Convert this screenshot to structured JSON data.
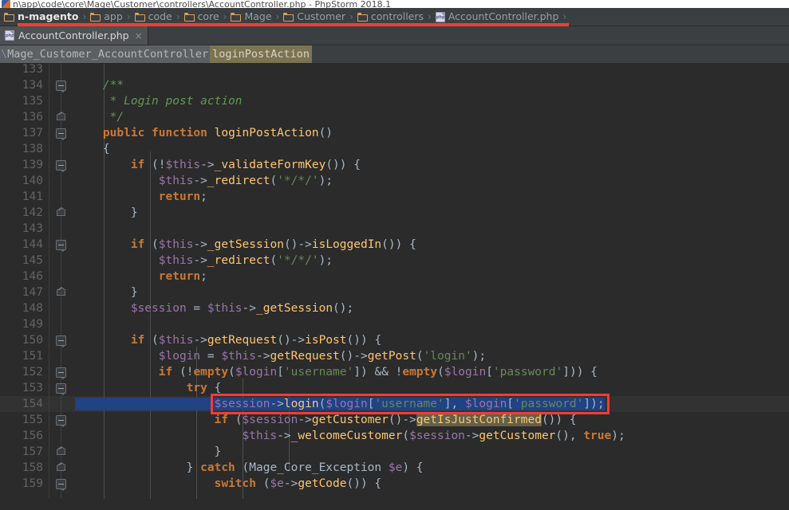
{
  "window": {
    "title": "n\\app\\code\\core\\Mage\\Customer\\controllers\\AccountController.php - PhpStorm 2018.1",
    "app_icon": "phpstorm-icon"
  },
  "breadcrumb": {
    "items": [
      {
        "label": "n-magento",
        "icon": "folder-icon",
        "current": true
      },
      {
        "label": "app",
        "icon": "folder-icon"
      },
      {
        "label": "code",
        "icon": "folder-icon"
      },
      {
        "label": "core",
        "icon": "folder-icon"
      },
      {
        "label": "Mage",
        "icon": "folder-icon"
      },
      {
        "label": "Customer",
        "icon": "folder-icon"
      },
      {
        "label": "controllers",
        "icon": "folder-icon"
      },
      {
        "label": "AccountController.php",
        "icon": "php-file-icon"
      }
    ],
    "separator": "›",
    "underline_color": "#f23b36"
  },
  "tabs": [
    {
      "label": "AccountController.php",
      "icon": "php-file-icon",
      "close": "×",
      "active": true
    }
  ],
  "navstrip": {
    "class_prefix": "\\",
    "class_name": "Mage_Customer_AccountController",
    "method_name": "loginPostAction"
  },
  "colors": {
    "editor_bg": "#2b2b2b",
    "chrome_bg": "#3c3f41",
    "gutter_text": "#606366",
    "default_text": "#a9b7c6",
    "keyword": "#cc7832",
    "function": "#ffc66d",
    "variable": "#9876aa",
    "string": "#6a8759",
    "comment": "#629755",
    "selection": "#214283",
    "identifier_highlight": "#63614a",
    "annotation": "#f23b36",
    "current_line": "#323232"
  },
  "editor": {
    "first_line": 133,
    "lines": [
      {
        "n": 133,
        "partial_top": true,
        "fold": null,
        "tokens": []
      },
      {
        "n": 134,
        "fold": "minus",
        "tokens": [
          {
            "t": "    ",
            "c": "def"
          },
          {
            "t": "/**",
            "c": "cmt"
          }
        ]
      },
      {
        "n": 135,
        "fold": null,
        "tokens": [
          {
            "t": "     ",
            "c": "def"
          },
          {
            "t": "* Login post action",
            "c": "cmt"
          }
        ]
      },
      {
        "n": 136,
        "fold": "end",
        "tokens": [
          {
            "t": "     ",
            "c": "def"
          },
          {
            "t": "*/",
            "c": "cmt"
          }
        ]
      },
      {
        "n": 137,
        "fold": "minus",
        "tokens": [
          {
            "t": "    ",
            "c": "def"
          },
          {
            "t": "public function ",
            "c": "kw"
          },
          {
            "t": "loginPostAction",
            "c": "fn"
          },
          {
            "t": "()",
            "c": "punct"
          }
        ]
      },
      {
        "n": 138,
        "fold": null,
        "tokens": [
          {
            "t": "    {",
            "c": "punct"
          }
        ]
      },
      {
        "n": 139,
        "fold": "minus",
        "tokens": [
          {
            "t": "        ",
            "c": "def"
          },
          {
            "t": "if ",
            "c": "kw"
          },
          {
            "t": "(!",
            "c": "punct"
          },
          {
            "t": "$this",
            "c": "var"
          },
          {
            "t": "->",
            "c": "punct"
          },
          {
            "t": "_validateFormKey",
            "c": "fn"
          },
          {
            "t": "()) {",
            "c": "punct"
          }
        ]
      },
      {
        "n": 140,
        "fold": null,
        "tokens": [
          {
            "t": "            ",
            "c": "def"
          },
          {
            "t": "$this",
            "c": "var"
          },
          {
            "t": "->",
            "c": "punct"
          },
          {
            "t": "_redirect",
            "c": "fn"
          },
          {
            "t": "(",
            "c": "punct"
          },
          {
            "t": "'*/*/'",
            "c": "str"
          },
          {
            "t": ");",
            "c": "punct"
          }
        ]
      },
      {
        "n": 141,
        "fold": null,
        "tokens": [
          {
            "t": "            ",
            "c": "def"
          },
          {
            "t": "return",
            "c": "kw"
          },
          {
            "t": ";",
            "c": "punct"
          }
        ]
      },
      {
        "n": 142,
        "fold": "end",
        "tokens": [
          {
            "t": "        }",
            "c": "punct"
          }
        ]
      },
      {
        "n": 143,
        "fold": null,
        "tokens": []
      },
      {
        "n": 144,
        "fold": "minus",
        "tokens": [
          {
            "t": "        ",
            "c": "def"
          },
          {
            "t": "if ",
            "c": "kw"
          },
          {
            "t": "(",
            "c": "punct"
          },
          {
            "t": "$this",
            "c": "var"
          },
          {
            "t": "->",
            "c": "punct"
          },
          {
            "t": "_getSession",
            "c": "fn"
          },
          {
            "t": "()->",
            "c": "punct"
          },
          {
            "t": "isLoggedIn",
            "c": "fn"
          },
          {
            "t": "()) {",
            "c": "punct"
          }
        ]
      },
      {
        "n": 145,
        "fold": null,
        "tokens": [
          {
            "t": "            ",
            "c": "def"
          },
          {
            "t": "$this",
            "c": "var"
          },
          {
            "t": "->",
            "c": "punct"
          },
          {
            "t": "_redirect",
            "c": "fn"
          },
          {
            "t": "(",
            "c": "punct"
          },
          {
            "t": "'*/*/'",
            "c": "str"
          },
          {
            "t": ");",
            "c": "punct"
          }
        ]
      },
      {
        "n": 146,
        "fold": null,
        "tokens": [
          {
            "t": "            ",
            "c": "def"
          },
          {
            "t": "return",
            "c": "kw"
          },
          {
            "t": ";",
            "c": "punct"
          }
        ]
      },
      {
        "n": 147,
        "fold": "end",
        "tokens": [
          {
            "t": "        }",
            "c": "punct"
          }
        ]
      },
      {
        "n": 148,
        "fold": null,
        "tokens": [
          {
            "t": "        ",
            "c": "def"
          },
          {
            "t": "$session",
            "c": "var"
          },
          {
            "t": " = ",
            "c": "punct"
          },
          {
            "t": "$this",
            "c": "var"
          },
          {
            "t": "->",
            "c": "punct"
          },
          {
            "t": "_getSession",
            "c": "fn"
          },
          {
            "t": "();",
            "c": "punct"
          }
        ]
      },
      {
        "n": 149,
        "fold": null,
        "tokens": []
      },
      {
        "n": 150,
        "fold": "minus",
        "tokens": [
          {
            "t": "        ",
            "c": "def"
          },
          {
            "t": "if ",
            "c": "kw"
          },
          {
            "t": "(",
            "c": "punct"
          },
          {
            "t": "$this",
            "c": "var"
          },
          {
            "t": "->",
            "c": "punct"
          },
          {
            "t": "getRequest",
            "c": "fn"
          },
          {
            "t": "()->",
            "c": "punct"
          },
          {
            "t": "isPost",
            "c": "fn"
          },
          {
            "t": "()) {",
            "c": "punct"
          }
        ]
      },
      {
        "n": 151,
        "fold": null,
        "tokens": [
          {
            "t": "            ",
            "c": "def"
          },
          {
            "t": "$login",
            "c": "var"
          },
          {
            "t": " = ",
            "c": "punct"
          },
          {
            "t": "$this",
            "c": "var"
          },
          {
            "t": "->",
            "c": "punct"
          },
          {
            "t": "getRequest",
            "c": "fn"
          },
          {
            "t": "()->",
            "c": "punct"
          },
          {
            "t": "getPost",
            "c": "fn"
          },
          {
            "t": "(",
            "c": "punct"
          },
          {
            "t": "'login'",
            "c": "str"
          },
          {
            "t": ");",
            "c": "punct"
          }
        ]
      },
      {
        "n": 152,
        "fold": "minus",
        "tokens": [
          {
            "t": "            ",
            "c": "def"
          },
          {
            "t": "if ",
            "c": "kw"
          },
          {
            "t": "(!",
            "c": "punct"
          },
          {
            "t": "empty",
            "c": "kw"
          },
          {
            "t": "(",
            "c": "punct"
          },
          {
            "t": "$login",
            "c": "var"
          },
          {
            "t": "[",
            "c": "punct"
          },
          {
            "t": "'username'",
            "c": "str"
          },
          {
            "t": "]) ",
            "c": "punct"
          },
          {
            "t": "&& ",
            "c": "op"
          },
          {
            "t": "!",
            "c": "punct"
          },
          {
            "t": "empty",
            "c": "kw"
          },
          {
            "t": "(",
            "c": "punct"
          },
          {
            "t": "$login",
            "c": "var"
          },
          {
            "t": "[",
            "c": "punct"
          },
          {
            "t": "'password'",
            "c": "str"
          },
          {
            "t": "])) {",
            "c": "punct"
          }
        ]
      },
      {
        "n": 153,
        "fold": "minus",
        "tokens": [
          {
            "t": "                ",
            "c": "def"
          },
          {
            "t": "try",
            "c": "kw"
          },
          {
            "t": " {",
            "c": "punct"
          }
        ]
      },
      {
        "n": 154,
        "fold": null,
        "current": true,
        "selected": true,
        "tokens": [
          {
            "t": "                    ",
            "c": "def"
          },
          {
            "t": "$session",
            "c": "var"
          },
          {
            "t": "->",
            "c": "punct"
          },
          {
            "t": "login",
            "c": "fn"
          },
          {
            "t": "(",
            "c": "punct"
          },
          {
            "t": "$login",
            "c": "var"
          },
          {
            "t": "[",
            "c": "punct"
          },
          {
            "t": "'username'",
            "c": "str"
          },
          {
            "t": "], ",
            "c": "punct"
          },
          {
            "t": "$login",
            "c": "var"
          },
          {
            "t": "[",
            "c": "punct"
          },
          {
            "t": "'password'",
            "c": "str"
          },
          {
            "t": "]);",
            "c": "punct"
          }
        ]
      },
      {
        "n": 155,
        "fold": "minus",
        "tokens": [
          {
            "t": "                    ",
            "c": "def"
          },
          {
            "t": "if ",
            "c": "kw"
          },
          {
            "t": "(",
            "c": "punct"
          },
          {
            "t": "$session",
            "c": "var"
          },
          {
            "t": "->",
            "c": "punct"
          },
          {
            "t": "getCustomer",
            "c": "fn"
          },
          {
            "t": "()->",
            "c": "punct"
          },
          {
            "t": "getIsJustConfirmed",
            "c": "fn",
            "hl": "ident"
          },
          {
            "t": "()) {",
            "c": "punct"
          }
        ]
      },
      {
        "n": 156,
        "fold": null,
        "tokens": [
          {
            "t": "                        ",
            "c": "def"
          },
          {
            "t": "$this",
            "c": "var"
          },
          {
            "t": "->",
            "c": "punct"
          },
          {
            "t": "_welcomeCustomer",
            "c": "fn"
          },
          {
            "t": "(",
            "c": "punct"
          },
          {
            "t": "$session",
            "c": "var"
          },
          {
            "t": "->",
            "c": "punct"
          },
          {
            "t": "getCustomer",
            "c": "fn"
          },
          {
            "t": "(), ",
            "c": "punct"
          },
          {
            "t": "true",
            "c": "kw"
          },
          {
            "t": ");",
            "c": "punct"
          }
        ]
      },
      {
        "n": 157,
        "fold": "end",
        "tokens": [
          {
            "t": "                    }",
            "c": "punct"
          }
        ]
      },
      {
        "n": 158,
        "fold": "end",
        "tokens": [
          {
            "t": "                } ",
            "c": "punct"
          },
          {
            "t": "catch ",
            "c": "kw"
          },
          {
            "t": "(",
            "c": "punct"
          },
          {
            "t": "Mage_Core_Exception ",
            "c": "ident"
          },
          {
            "t": "$e",
            "c": "var"
          },
          {
            "t": ") {",
            "c": "punct"
          }
        ]
      },
      {
        "n": 159,
        "fold": "minus",
        "partial_bottom": true,
        "tokens": [
          {
            "t": "                    ",
            "c": "def"
          },
          {
            "t": "switch ",
            "c": "kw"
          },
          {
            "t": "(",
            "c": "punct"
          },
          {
            "t": "$e",
            "c": "var"
          },
          {
            "t": "->",
            "c": "punct"
          },
          {
            "t": "getCode",
            "c": "fn"
          },
          {
            "t": "()) {",
            "c": "punct"
          }
        ]
      }
    ]
  },
  "annotations": [
    {
      "name": "breadcrumb-underline",
      "kind": "underline"
    },
    {
      "name": "selected-code-line-box",
      "kind": "rect",
      "target_line": 154
    }
  ]
}
